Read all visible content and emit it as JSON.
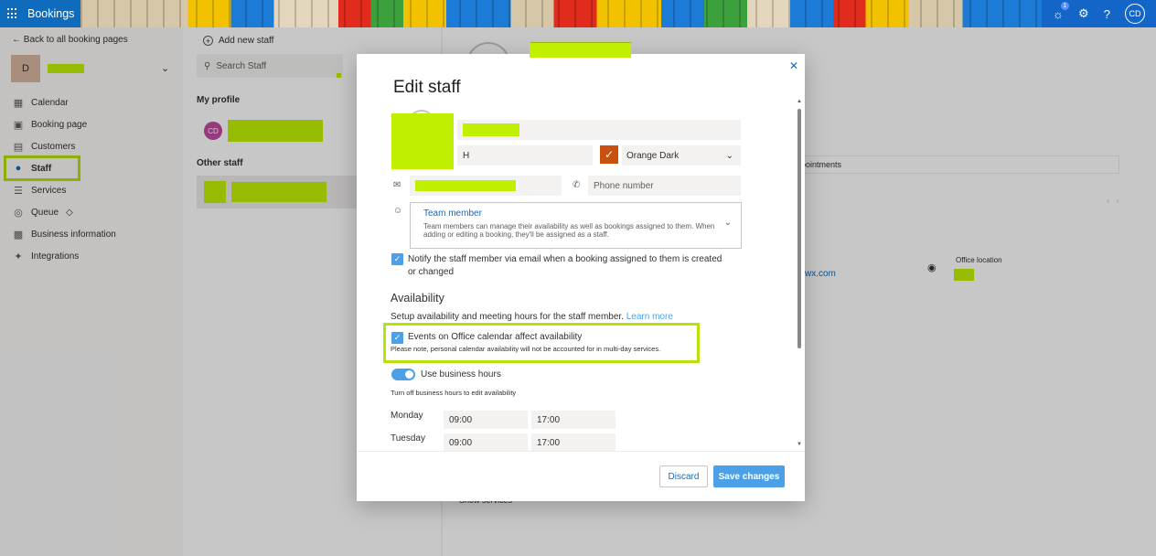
{
  "topbar": {
    "app_name": "Bookings",
    "notification_count": "1",
    "avatar_initials": "CD",
    "icons": [
      "waffle-icon",
      "lightbulb-icon",
      "gear-icon",
      "help-icon"
    ]
  },
  "leftnav": {
    "back_label": "Back to all booking pages",
    "business_avatar": "D",
    "items": [
      {
        "label": "Calendar",
        "icon": "calendar-icon"
      },
      {
        "label": "Booking page",
        "icon": "monitor-icon"
      },
      {
        "label": "Customers",
        "icon": "contact-card-icon"
      },
      {
        "label": "Staff",
        "icon": "people-icon"
      },
      {
        "label": "Services",
        "icon": "services-icon"
      },
      {
        "label": "Queue",
        "icon": "diamond-icon"
      },
      {
        "label": "Business information",
        "icon": "building-icon"
      },
      {
        "label": "Integrations",
        "icon": "integrations-icon"
      }
    ]
  },
  "staff_panel": {
    "add_label": "Add new staff",
    "search_placeholder": "Search Staff",
    "my_profile_title": "My profile",
    "my_profile_initials": "CD",
    "other_staff_title": "Other staff"
  },
  "detail": {
    "tab_partial": "ppointments",
    "email_partial": "wx.com",
    "office_location_label": "Office location",
    "show_services": "Show services"
  },
  "modal": {
    "title": "Edit staff",
    "initials_value": "H",
    "color_name": "Orange Dark",
    "phone_placeholder": "Phone number",
    "role": {
      "title": "Team member",
      "description": "Team members can manage their availability as well as bookings assigned to them. When adding or editing a booking, they'll be assigned as a staff."
    },
    "notify_label": "Notify the staff member via email when a booking assigned to them is created or changed",
    "availability_title": "Availability",
    "availability_desc": "Setup availability and meeting hours for the staff member.",
    "learn_more": "Learn more",
    "office_cal_label": "Events on Office calendar affect availability",
    "office_cal_note": "Please note, personal calendar availability will not be accounted for in multi-day services.",
    "business_hours_label": "Use business hours",
    "business_hours_note": "Turn off business hours to edit availability",
    "days": [
      {
        "day": "Monday",
        "start": "09:00",
        "end": "17:00"
      },
      {
        "day": "Tuesday",
        "start": "09:00",
        "end": "17:00"
      }
    ],
    "discard_label": "Discard",
    "save_label": "Save changes"
  },
  "colors": {
    "brand": "#0f6cbd",
    "accent": "#4ca0e8",
    "highlight": "#b6e10b",
    "staff_color": "#ca5010"
  }
}
